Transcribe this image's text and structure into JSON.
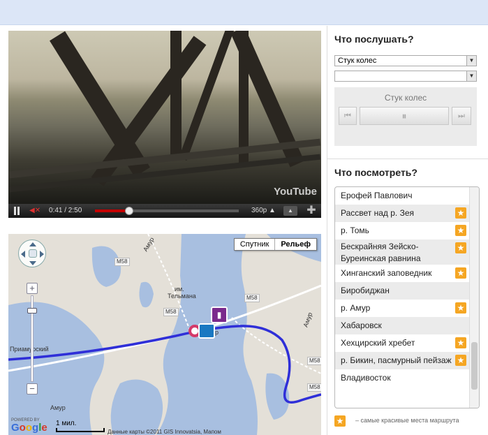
{
  "video": {
    "watermark": "YouTube",
    "time": "0:41 / 2:50",
    "progress": 0.24,
    "quality": "360p"
  },
  "map": {
    "type_buttons": [
      "Спутник",
      "Рельеф"
    ],
    "labels": {
      "amur_top": "Амур",
      "amur_left": "Амур",
      "amur_right": "Амур",
      "im": "им.",
      "telmana": "Тельмана",
      "primamursky": "Приамурский",
      "r": "р"
    },
    "shields": [
      "M58",
      "M58",
      "M58",
      "M58",
      "M58"
    ],
    "powered_by": "POWERED BY",
    "google": "Google",
    "scale": "1 мил.",
    "copyright": "Данные карты ©2011 GIS Innovatsia, Мапом"
  },
  "listen": {
    "title": "Что послушать?",
    "select_value": "Стук колес",
    "player_title": "Стук колес",
    "prev_icon": "⏮",
    "play_icon": "⏸",
    "next_icon": "⏭"
  },
  "watch": {
    "title": "Что посмотреть?",
    "places": [
      {
        "name": "Ерофей Павлович",
        "star": false
      },
      {
        "name": "Рассвет над р. Зея",
        "star": true
      },
      {
        "name": "р. Томь",
        "star": true
      },
      {
        "name": "Бескрайняя Зейско-Буреинская равнина",
        "star": true
      },
      {
        "name": "Хинганский заповедник",
        "star": true
      },
      {
        "name": "Биробиджан",
        "star": false
      },
      {
        "name": "р. Амур",
        "star": true
      },
      {
        "name": "Хабаровск",
        "star": false
      },
      {
        "name": "Хехцирский хребет",
        "star": true
      },
      {
        "name": "р. Бикин, пасмурный пейзаж",
        "star": true
      },
      {
        "name": "Владивосток",
        "star": false
      }
    ],
    "legend": "– самые красивые места маршрута"
  },
  "colors": {
    "accent_star": "#f5a623",
    "route": "#2f2fd8",
    "water": "#a8bfe0",
    "progress": "#c40000"
  }
}
